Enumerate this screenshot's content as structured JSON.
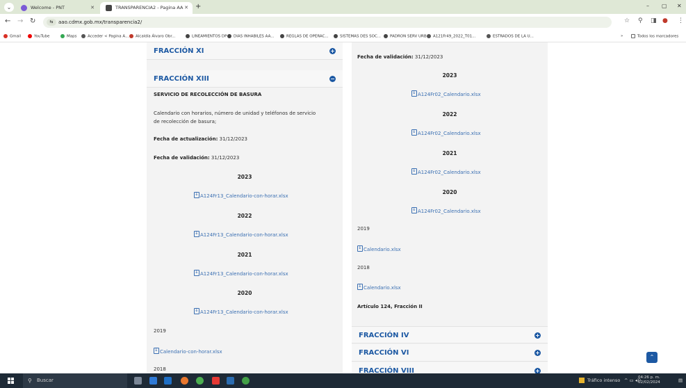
{
  "browser": {
    "tabs": [
      {
        "title": "Welcome - PNT"
      },
      {
        "title": "TRANSPARENCIA2 - Pagina AA"
      }
    ],
    "address": "aao.cdmx.gob.mx/transparencia2/",
    "bookmarks": [
      "Gmail",
      "YouTube",
      "Maps",
      "Acceder < Pagina A...",
      "Alcaldía Álvaro Obr...",
      "LINEAMIENTOS DP",
      "DIAS INHABILES AA...",
      "REGLAS DE OPERAC...",
      "SISTEMAS DES SOC...",
      "PADRON SERV URB",
      "A121Fr49_2022_T01...",
      "ESTRADOS DE LA U..."
    ],
    "bookmarks_more": "Todos los marcadores"
  },
  "left": {
    "frac_xi": "FRACCIÓN XI",
    "frac_xiii": "FRACCIÓN XIII",
    "service_title": "SERVICIO DE RECOLECCIÓN DE BASURA",
    "desc_line1": "Calendario con horarios, número de unidad y teléfonos de servicio",
    "desc_line2": "de recolección de basura;",
    "upd_label": "Fecha de actualización:",
    "upd_value": " 31/12/2023",
    "val_label": "Fecha de validación:",
    "val_value": " 31/12/2023",
    "years": [
      {
        "year": "2023",
        "file": "A124Fr13_Calendario-con-horar.xlsx"
      },
      {
        "year": "2022",
        "file": "A124Fr13_Calendario-con-horar.xlsx"
      },
      {
        "year": "2021",
        "file": "A124Fr13_Calendario-con-horar.xlsx"
      },
      {
        "year": "2020",
        "file": "A124Fr13_Calendario-con-horar.xlsx"
      }
    ],
    "y2019": "2019",
    "file2019": "Calendario-con-horar.xlsx",
    "y2018": "2018"
  },
  "right": {
    "val_label": "Fecha de validación:",
    "val_value": " 31/12/2023",
    "years": [
      {
        "year": "2023",
        "file": "A124Fr02_Calendario.xlsx"
      },
      {
        "year": "2022",
        "file": "A124Fr02_Calendario.xlsx"
      },
      {
        "year": "2021",
        "file": "A124Fr02_Calendario.xlsx"
      },
      {
        "year": "2020",
        "file": "A124Fr02_Calendario.xlsx"
      }
    ],
    "y2019": "2019",
    "file2019": "Calendario.xlsx",
    "y2018": "2018",
    "file2018": "Calendario.xlsx",
    "articulo": "Artículo 124, Fracción II",
    "frac_iv": "FRACCIÓN IV",
    "frac_vi": "FRACCIÓN VI",
    "frac_viii": "FRACCIÓN VIII"
  },
  "taskbar": {
    "search_placeholder": "Buscar",
    "weather": "Tráfico intenso",
    "time": "04:26 p. m.",
    "date": "02/02/2024"
  },
  "colors": {
    "accent": "#1d59a3",
    "link": "#3a6fb2",
    "panel": "#f3f3f3"
  }
}
